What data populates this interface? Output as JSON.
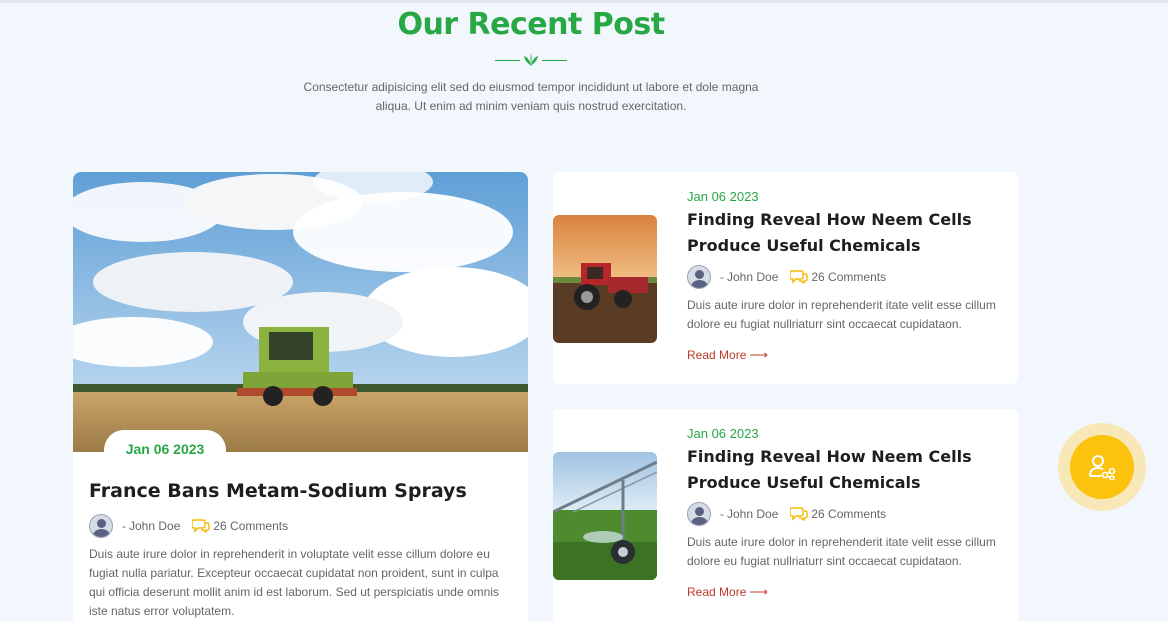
{
  "section": {
    "title": "Our Recent Post",
    "intro": "Consectetur adipisicing elit sed do eiusmod tempor incididunt ut labore et dole magna aliqua. Ut enim ad minim veniam quis nostrud exercitation."
  },
  "featured": {
    "date": "Jan 06 2023",
    "title": "France Bans Metam-Sodium Sprays",
    "author": "John Doe",
    "comments": "26 Comments",
    "excerpt": "Duis aute irure dolor in reprehenderit in voluptate velit esse cillum dolore eu fugiat nulla pariatur. Excepteur occaecat cupidatat non proident, sunt in culpa qui officia deserunt mollit anim id est laborum. Sed ut perspiciatis unde omnis iste natus error voluptatem."
  },
  "posts": [
    {
      "date": "Jan 06 2023",
      "title": "Finding Reveal How Neem Cells Produce Useful Chemicals",
      "author": "John Doe",
      "comments": "26 Comments",
      "excerpt": "Duis aute irure dolor in reprehenderit itate velit esse cillum dolore eu fugiat nullriaturr sint occaecat cupidataon.",
      "read_more": "Read More"
    },
    {
      "date": "Jan 06 2023",
      "title": "Finding Reveal How Neem Cells Produce Useful Chemicals",
      "author": "John Doe",
      "comments": "26 Comments",
      "excerpt": "Duis aute irure dolor in reprehenderit itate velit esse cillum dolore eu fugiat nullriaturr sint occaecat cupidataon.",
      "read_more": "Read More"
    }
  ],
  "meta": {
    "dash": "-"
  },
  "icons": {
    "divider": "leaf-divider-icon",
    "author": "user-avatar-icon",
    "comments": "chat-bubbles-icon",
    "read_more": "arrow-right-icon",
    "floating": "user-share-icon"
  },
  "colors": {
    "accent_green": "#28a745",
    "read_more_red": "#c0392b",
    "comment_icon": "#f5b800",
    "floating_button": "#fbc20e",
    "background": "#f2f7fd"
  }
}
